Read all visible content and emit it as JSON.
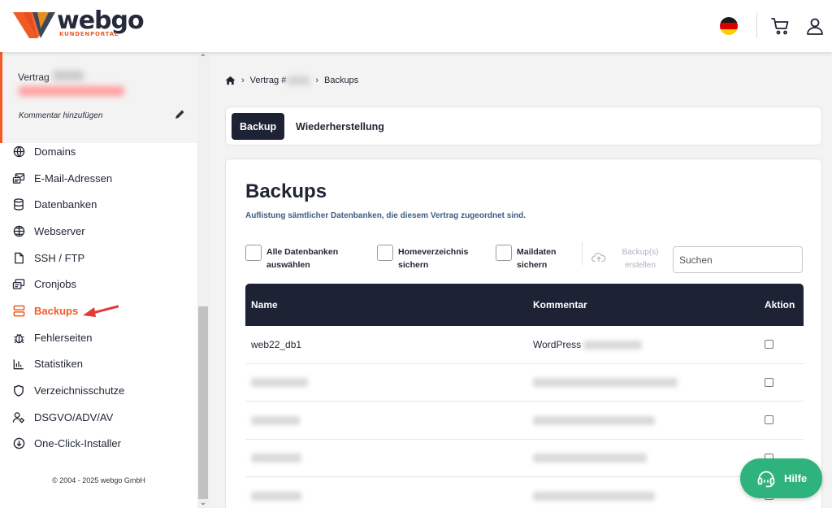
{
  "header": {
    "logo_text": "webgo",
    "logo_subtitle": "KUNDENPORTAL",
    "icons": [
      "flag-de-icon",
      "cart-icon",
      "user-icon"
    ]
  },
  "sidebar": {
    "contract_label": "Vertrag",
    "comment_link": "Kommentar hinzufügen",
    "items": [
      {
        "label": "Domains",
        "icon": "globe-icon"
      },
      {
        "label": "E-Mail-Adressen",
        "icon": "mail-icon"
      },
      {
        "label": "Datenbanken",
        "icon": "database-icon"
      },
      {
        "label": "Webserver",
        "icon": "webserver-icon"
      },
      {
        "label": "SSH / FTP",
        "icon": "file-icon"
      },
      {
        "label": "Cronjobs",
        "icon": "cron-icon"
      },
      {
        "label": "Backups",
        "icon": "backup-icon",
        "active": true
      },
      {
        "label": "Fehlerseiten",
        "icon": "bug-icon"
      },
      {
        "label": "Statistiken",
        "icon": "stats-icon"
      },
      {
        "label": "Verzeichnisschutze",
        "icon": "shield-icon"
      },
      {
        "label": "DSGVO/ADV/AV",
        "icon": "user-settings-icon"
      },
      {
        "label": "One-Click-Installer",
        "icon": "download-icon"
      }
    ],
    "copyright": "© 2004 - 2025 webgo GmbH"
  },
  "breadcrumb": {
    "contract": "Vertrag #",
    "current": "Backups"
  },
  "tabs": {
    "backup": "Backup",
    "restore": "Wiederherstellung"
  },
  "main": {
    "title": "Backups",
    "subtitle": "Auflistung sämtlicher Datenbanken, die diesem Vertrag zugeordnet sind.",
    "options": {
      "all_db": "Alle Datenbanken auswählen",
      "home": "Homeverzeichnis sichern",
      "mail": "Maildaten sichern"
    },
    "create_button": "Backup(s) erstellen",
    "search_placeholder": "Suchen"
  },
  "table": {
    "headers": {
      "name": "Name",
      "comment": "Kommentar",
      "action": "Aktion"
    },
    "rows": [
      {
        "name": "web22_db1",
        "comment": "WordPress"
      }
    ]
  },
  "help": {
    "label": "Hilfe"
  },
  "colors": {
    "accent": "#f15a24",
    "dark": "#1d2234",
    "help": "#2fb37d"
  }
}
